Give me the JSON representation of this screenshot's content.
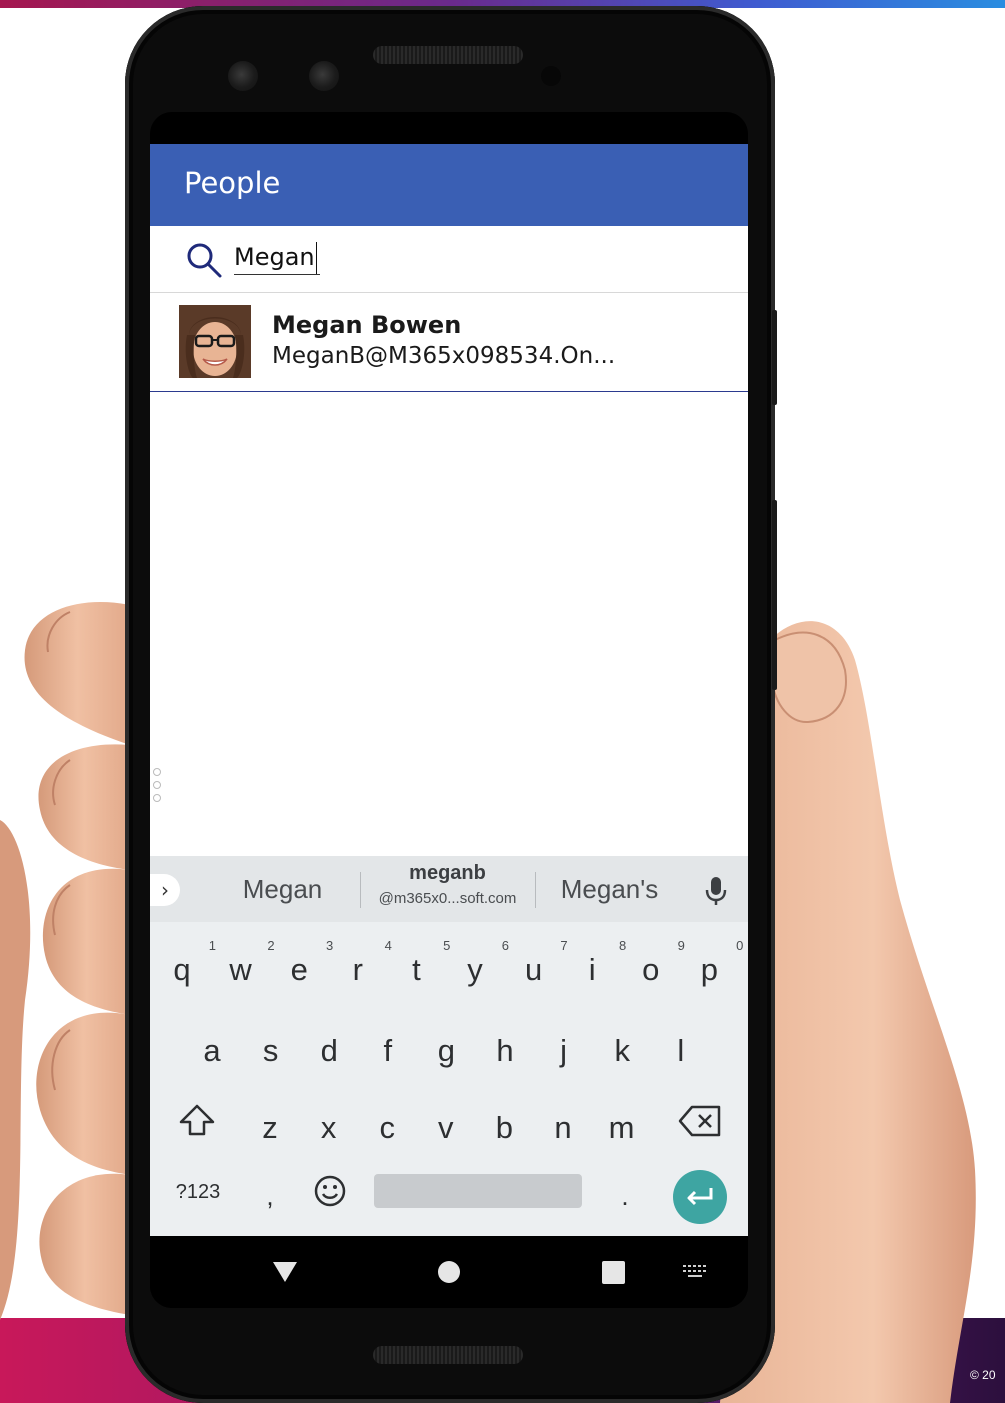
{
  "footer": {
    "copyright": "© 20"
  },
  "app": {
    "title": "People",
    "search": {
      "value": "Megan"
    },
    "results": [
      {
        "name": "Megan Bowen",
        "email": "MeganB@M365x098534.On..."
      }
    ]
  },
  "keyboard": {
    "suggestions": {
      "left": "Megan",
      "middle_title": "meganb",
      "middle_sub": "@m365x0...soft.com",
      "right": "Megan's"
    },
    "row1": [
      {
        "key": "q",
        "hint": "1"
      },
      {
        "key": "w",
        "hint": "2"
      },
      {
        "key": "e",
        "hint": "3"
      },
      {
        "key": "r",
        "hint": "4"
      },
      {
        "key": "t",
        "hint": "5"
      },
      {
        "key": "y",
        "hint": "6"
      },
      {
        "key": "u",
        "hint": "7"
      },
      {
        "key": "i",
        "hint": "8"
      },
      {
        "key": "o",
        "hint": "9"
      },
      {
        "key": "p",
        "hint": "0"
      }
    ],
    "row2": [
      "a",
      "s",
      "d",
      "f",
      "g",
      "h",
      "j",
      "k",
      "l"
    ],
    "row3": [
      "z",
      "x",
      "c",
      "v",
      "b",
      "n",
      "m"
    ],
    "symbols_label": "?123",
    "comma": ",",
    "period": "."
  },
  "colors": {
    "header": "#3a5fb4",
    "enter_key": "#3ea5a2",
    "keyboard_bg": "#eceff1"
  },
  "icons": {
    "search": "search-icon",
    "mic": "mic-icon",
    "shift": "shift-icon",
    "backspace": "backspace-icon",
    "emoji": "emoji-icon",
    "enter": "enter-icon",
    "nav_back": "back-triangle-icon",
    "nav_home": "home-circle-icon",
    "nav_recents": "recents-square-icon",
    "nav_keyboard": "keyboard-switch-icon"
  }
}
